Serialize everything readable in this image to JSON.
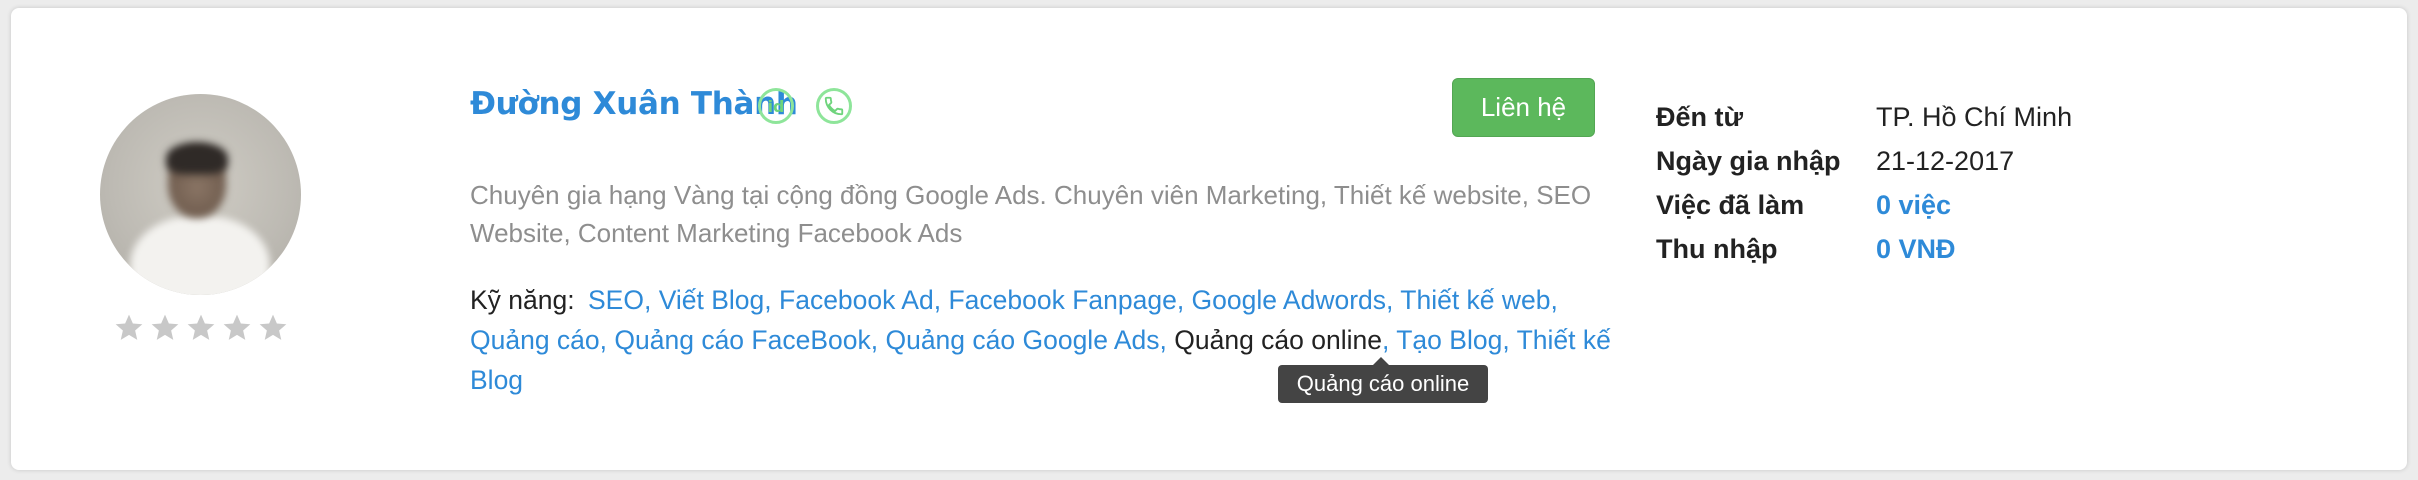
{
  "profile": {
    "name": "Đường Xuân Thành",
    "id_badge": "id",
    "contact_label": "Liên hệ",
    "description": "Chuyên gia hạng Vàng tại cộng đồng Google Ads. Chuyên viên Marketing, Thiết kế website, SEO Website, Content Marketing Facebook Ads",
    "rating": {
      "filled": 0,
      "max": 5
    }
  },
  "skills": {
    "label": "Kỹ năng:",
    "items": [
      "SEO",
      "Viết Blog",
      "Facebook Ad",
      "Facebook Fanpage",
      "Google Adwords",
      "Thiết kế web",
      "Quảng cáo",
      "Quảng cáo FaceBook",
      "Quảng cáo Google Ads",
      "Quảng cáo online",
      "Tạo Blog",
      "Thiết kế Blog"
    ],
    "hovered_index": 9,
    "tooltip": "Quảng cáo online"
  },
  "stats": [
    {
      "label": "Đến từ",
      "value": "TP. Hồ Chí Minh",
      "is_link": false
    },
    {
      "label": "Ngày gia nhập",
      "value": "21-12-2017",
      "is_link": false
    },
    {
      "label": "Việc đã làm",
      "value": "0 việc",
      "is_link": true
    },
    {
      "label": "Thu nhập",
      "value": "0 VNĐ",
      "is_link": true
    }
  ],
  "colors": {
    "accent": "#2e8ad8",
    "button": "#5cb85c",
    "badge": "#8ee59a",
    "muted_text": "#8e8e8e",
    "star": "#c8c8c8"
  },
  "icons": {
    "id_badge": "id-verified-icon",
    "phone_badge": "phone-verified-icon",
    "star": "star-icon"
  }
}
